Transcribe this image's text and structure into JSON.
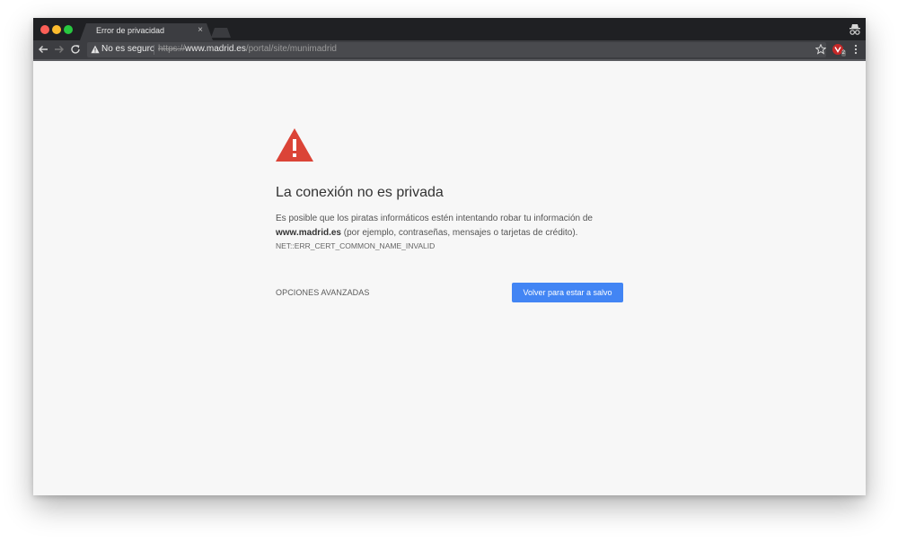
{
  "tab": {
    "title": "Error de privacidad",
    "close_glyph": "×"
  },
  "omnibox": {
    "security_label": "No es seguro",
    "url_scheme": "https://",
    "url_host": "www.madrid.es",
    "url_path": "/portal/site/munimadrid"
  },
  "extension": {
    "badge": "2"
  },
  "interstitial": {
    "heading": "La conexión no es privada",
    "explanation_before": "Es posible que los piratas informáticos estén intentando robar tu información de ",
    "explanation_host": "www.madrid.es",
    "explanation_after": " (por ejemplo, contraseñas, mensajes o tarjetas de crédito).",
    "error_code": "NET::ERR_CERT_COMMON_NAME_INVALID",
    "advanced_label": "OPCIONES AVANZADAS",
    "back_button_label": "Volver para estar a salvo"
  },
  "colors": {
    "warning_red": "#db4437",
    "primary_blue": "#4285f4",
    "chrome_dark": "#1f2023",
    "toolbar": "#3c3d41",
    "page_background": "#f7f7f7"
  },
  "icons": {
    "back": "arrow-left-icon",
    "forward": "arrow-right-icon",
    "reload": "reload-icon",
    "security": "warning-triangle-icon",
    "bookmark": "star-icon",
    "extension": "extension-icon",
    "menu": "kebab-menu-icon",
    "incognito": "incognito-icon"
  }
}
